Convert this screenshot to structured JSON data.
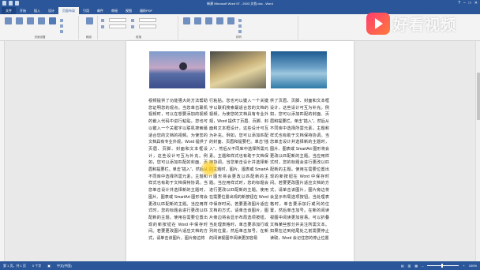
{
  "window": {
    "title": "新建 Microsoft Word 97 - 2003 文档.doc - Word"
  },
  "tabs": [
    "文件",
    "开始",
    "插入",
    "设计",
    "页面布局",
    "引用",
    "邮件",
    "审阅",
    "视图",
    "福昕PDF"
  ],
  "ribbon": {
    "group_labels": [
      "页面设置",
      "稿纸",
      "段落",
      "排列"
    ]
  },
  "document": {
    "columns": [
      "视频提供了功能强大的方法帮助您证明您的观点。当您单击联机视频时，可以在想要添加的视频的嵌入代码中进行粘贴。您也可以键入一个关键字以联机搜索最适合您的文档的视频。为使您的文档具有专业外观，Word 提供了页眉、页脚、封面和文本框设计，这些设计可互为补充。例如，您可以添加匹配的封面、页眉和提要栏。单击“插入”，然后从不同库中选择所需元素。主题和样式也有助于文档保持协调。当您单击设计并选择新的主题时，图片、图表或 SmartArt 图形将会更改以匹配新的主题。当应用样式时，您的标题会进行更改以匹配新的主题。使用在需要位置出现的新按钮在 Word 中保存时间。若要更改图片适应文档的方式，请单击该图片，图片旁边将",
      "行粘贴。您也可以键入一个关键字以联机搜索最适合您的文档的视频。为使您的文档具有专业外观，Word 提供了页眉、页脚、封面和文本框设计，这些设计可互为补充。例如，您可以添加匹配的封面、页眉和提要栏。单击“插入”，然后从不同库中选择所需元素。主题和样式也有助于文档保持协调。当您单击设计并选择新的主题时，图片、图表或 SmartArt 图形将会更改以匹配新的主题。当应用样式时，您的标题会进行更改以匹配新的主题。使用在需要位置出现的新按钮在 Word 中保存时间。若要更改图片适应文档的方式，请单击该图片，图片旁边将会显示布局选项按钮。当处理表格时，单击要添加行或列的位置，然后单击加号。在新的阅读视图中阅读更加容易",
      "供了页眉、页脚、封面和文本框设计，这些设计可互为补充。例如，您可以添加匹配的封面、页眉和提要栏。单击“插入”，然后从不同库中选择所需元素。主题和样式也有助于文档保持协调。当您单击设计并选择新的主题时，图片、图表或 SmartArt 图形将会更改以匹配新的主题。当应用样式时，您的标题会进行更改以匹配新的主题。使用在需要位置出现的新按钮在 Word 中保存时间。若要更改图片适应文档的方式，请单击该图片，图片旁边将会显示布局选项按钮。当处理表格时，单击要添加行或列的位置，然后单击加号。在新的阅读视图中阅读更加容易。可以折叠文档某些部分并关注所需文本。如果在达到结尾处之前需要停止读取，Word 会记住您的停止位置"
    ]
  },
  "watermark": {
    "text": "好看视频"
  },
  "status": {
    "page": "第 1 页，共 1 页",
    "words": "0 个字",
    "lang": "中文(中国)",
    "zoom": "100%"
  },
  "colors": {
    "word_blue": "#2b579a",
    "cursor_highlight": "#ffd21e"
  }
}
